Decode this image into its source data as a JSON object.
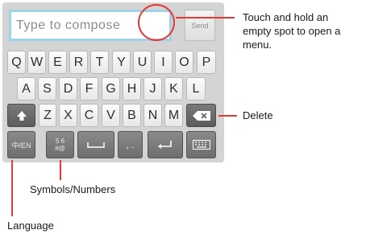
{
  "compose": {
    "placeholder": "Type to compose",
    "send_label": "Send"
  },
  "keyboard": {
    "row1": [
      "Q",
      "W",
      "E",
      "R",
      "T",
      "Y",
      "U",
      "I",
      "O",
      "P"
    ],
    "row2": [
      "A",
      "S",
      "D",
      "F",
      "G",
      "H",
      "J",
      "K",
      "L"
    ],
    "row3": [
      "Z",
      "X",
      "C",
      "V",
      "B",
      "N",
      "M"
    ],
    "language_label": "中/EN",
    "symbols_top": "5 6",
    "symbols_bottom": "#@",
    "comma_period": ", ."
  },
  "annotations": {
    "menu": [
      "Touch and hold an",
      "empty spot to open a",
      "menu."
    ],
    "delete": "Delete",
    "symbols": "Symbols/Numbers",
    "language": "Language"
  },
  "colors": {
    "callout_line": "#e53935",
    "input_border": "#9fd4e8",
    "keyboard_bg": "#d4d4d4"
  },
  "icons": [
    "shift-icon",
    "backspace-icon",
    "space-icon",
    "enter-icon",
    "keyboard-hide-icon"
  ]
}
